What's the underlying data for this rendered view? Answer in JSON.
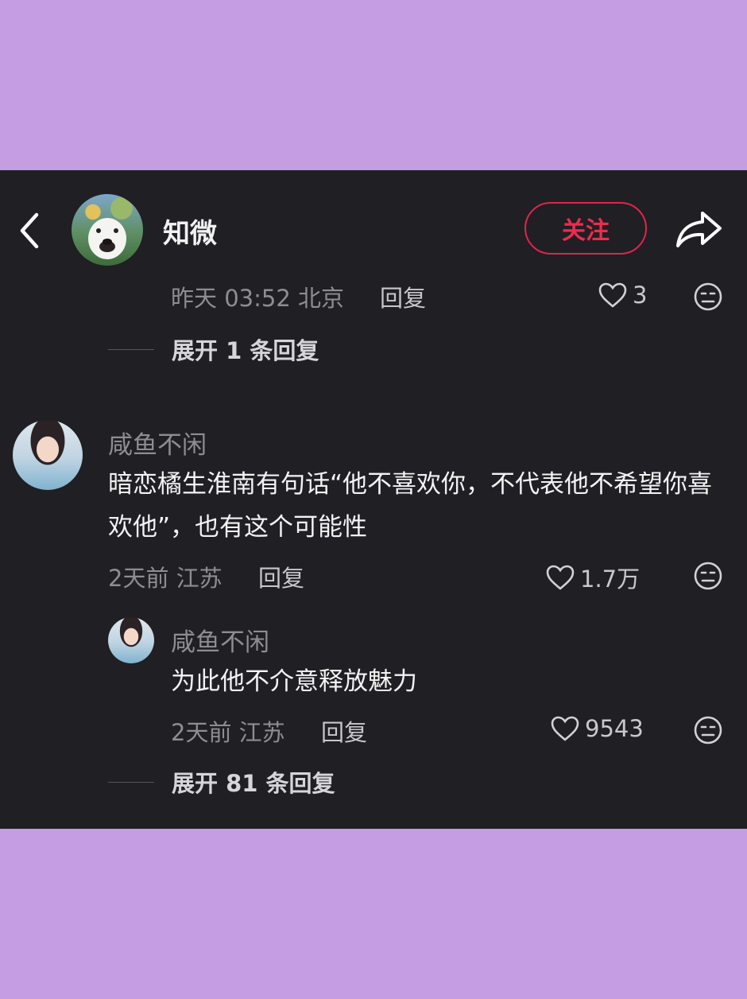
{
  "header": {
    "owner_name": "知微",
    "follow_label": "关注"
  },
  "top_comment": {
    "time_location": "昨天 03:52 北京",
    "reply_label": "回复",
    "likes": "3",
    "expand_label": "展开 1 条回复"
  },
  "comment": {
    "username": "咸鱼不闲",
    "text": "暗恋橘生淮南有句话“他不喜欢你，不代表他不希望你喜欢他”，也有这个可能性",
    "time_location": "2天前 江苏",
    "reply_label": "回复",
    "likes": "1.7万"
  },
  "reply": {
    "username": "咸鱼不闲",
    "text": "为此他不介意释放魅力",
    "time_location": "2天前 江苏",
    "reply_label": "回复",
    "likes": "9543",
    "expand_label": "展开 81 条回复"
  },
  "colors": {
    "background": "#c59de3",
    "panel": "#1f1f24",
    "accent": "#ee2b4f"
  }
}
